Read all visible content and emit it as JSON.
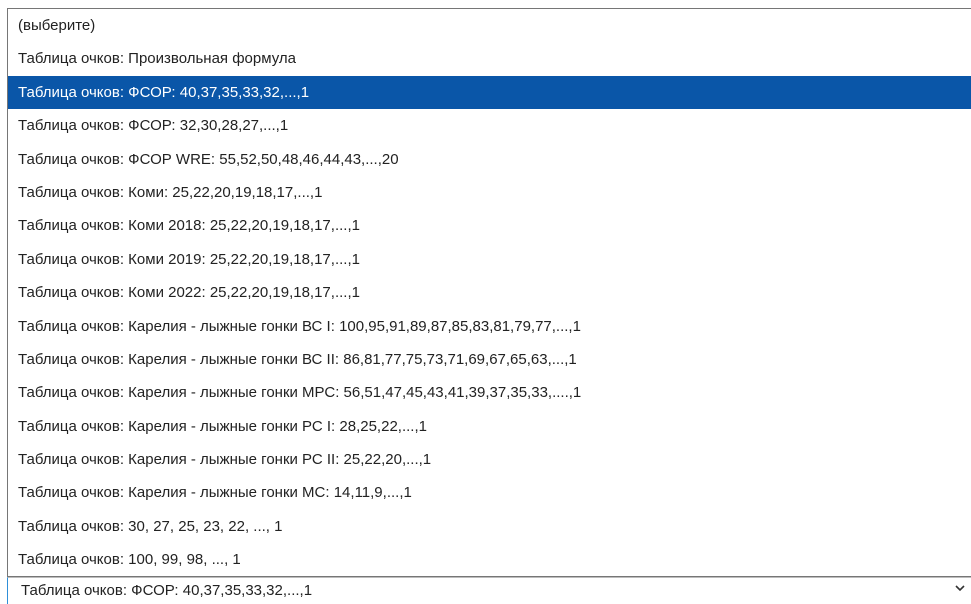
{
  "dropdown": {
    "options": [
      "(выберите)",
      "Таблица очков: Произвольная формула",
      "Таблица очков: ФСОР: 40,37,35,33,32,...,1",
      "Таблица очков: ФСОР: 32,30,28,27,...,1",
      "Таблица очков: ФСОР WRE: 55,52,50,48,46,44,43,...,20",
      "Таблица очков: Коми: 25,22,20,19,18,17,...,1",
      "Таблица очков: Коми 2018: 25,22,20,19,18,17,...,1",
      "Таблица очков: Коми 2019: 25,22,20,19,18,17,...,1",
      "Таблица очков: Коми 2022: 25,22,20,19,18,17,...,1",
      "Таблица очков: Карелия - лыжные гонки ВС I: 100,95,91,89,87,85,83,81,79,77,...,1",
      "Таблица очков: Карелия - лыжные гонки ВС II: 86,81,77,75,73,71,69,67,65,63,...,1",
      "Таблица очков: Карелия - лыжные гонки МРС: 56,51,47,45,43,41,39,37,35,33,....,1",
      "Таблица очков: Карелия - лыжные гонки РС I: 28,25,22,...,1",
      "Таблица очков: Карелия - лыжные гонки РС II: 25,22,20,...,1",
      "Таблица очков: Карелия - лыжные гонки МС: 14,11,9,...,1",
      "Таблица очков: 30, 27, 25, 23, 22, ..., 1",
      "Таблица очков: 100, 99, 98, ..., 1"
    ],
    "selected_value": "Таблица очков: ФСОР: 40,37,35,33,32,...,1",
    "chevron_icon": "chevron-down-icon",
    "colors": {
      "highlight": "#0a56a8",
      "highlight_text": "#ffffff",
      "text": "#222222",
      "focus_border": "#2f8fd8"
    }
  }
}
